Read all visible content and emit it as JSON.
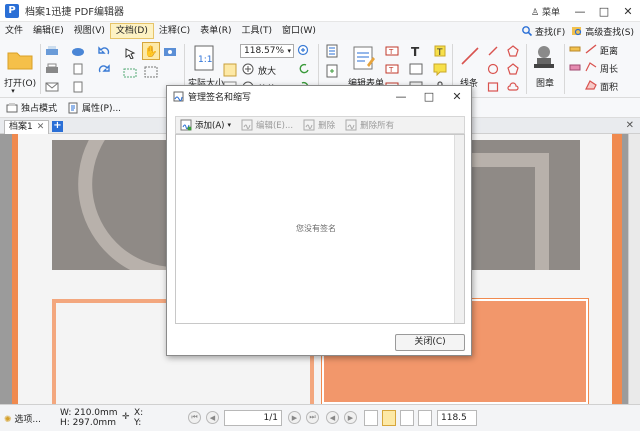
{
  "window": {
    "title": "档案1迅捷 PDF编辑器",
    "menu_label": "菜单",
    "minimize": "—",
    "maximize": "□",
    "close": "✕"
  },
  "menubar": {
    "items": [
      "文件",
      "编辑(E)",
      "视图(V)",
      "文档(D)",
      "注释(C)",
      "表单(R)",
      "工具(T)",
      "窗口(W)"
    ],
    "active_index": 3,
    "right_tools": [
      "查找(F)",
      "高级查找(S)"
    ]
  },
  "ribbon": {
    "open_label": "打开(O)",
    "actual_size_label": "实际大小",
    "zoom_value": "118.57%",
    "zoom_in_label": "放大",
    "zoom_out_label": "缩放",
    "edit_form_label": "编辑表单",
    "lines_label": "线条",
    "stamp_label": "图章",
    "distance_label": "距离",
    "perimeter_label": "周长",
    "area_label": "面积"
  },
  "subtoolbar": {
    "items": [
      "独占模式",
      "属性(P)..."
    ]
  },
  "tabs": {
    "items": [
      "档案1"
    ],
    "close_glyph": "✕",
    "add_glyph": "+"
  },
  "dialog": {
    "title": "管理签名和缩写",
    "toolbar": [
      {
        "label": "添加(A)",
        "enabled": true
      },
      {
        "label": "编辑(E)...",
        "enabled": false
      },
      {
        "label": "删除",
        "enabled": false
      },
      {
        "label": "删除所有",
        "enabled": false
      }
    ],
    "empty_message": "您没有签名",
    "close_button": "关闭(C)"
  },
  "statusbar": {
    "options_label": "选项...",
    "width": "W: 210.0mm",
    "height": "H: 297.0mm",
    "x_label": "X:",
    "y_label": "Y:",
    "page_display": "1/1",
    "zoom_display": "118.5"
  },
  "colors": {
    "accent_blue": "#2a6fd6",
    "active_menu": "#fdf2c4",
    "page_orange": "#f08a4f",
    "page_gray": "#8f8a86"
  }
}
